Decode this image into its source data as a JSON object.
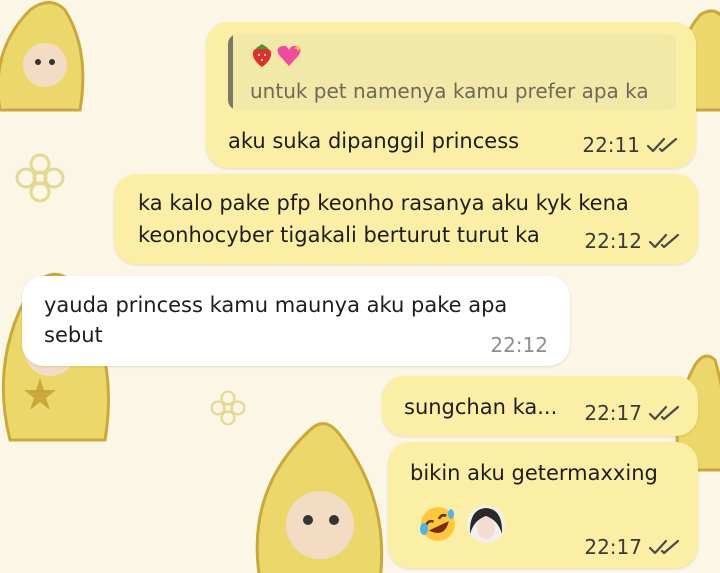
{
  "messages": [
    {
      "id": "m1",
      "direction": "outgoing",
      "reply_to": {
        "emojis": [
          "strawberry",
          "sparkling-heart"
        ],
        "text": "untuk pet namenya kamu prefer apa ka"
      },
      "lines": [
        "aku suka dipanggil princess"
      ],
      "time": "22:11",
      "status": "read"
    },
    {
      "id": "m2",
      "direction": "outgoing",
      "lines": [
        "ka kalo pake pfp keonho rasanya aku kyk kena",
        "keonhocyber tigakali berturut turut ka"
      ],
      "time": "22:12",
      "status": "read"
    },
    {
      "id": "m3",
      "direction": "incoming",
      "lines": [
        "yauda princess kamu maunya aku pake apa",
        "sebut"
      ],
      "time": "22:12"
    },
    {
      "id": "m4",
      "direction": "outgoing",
      "lines": [
        "sungchan ka..."
      ],
      "time": "22:17",
      "status": "read"
    },
    {
      "id": "m5",
      "direction": "outgoing",
      "lines": [
        "bikin aku getermaxxing"
      ],
      "reactions": [
        "rolling-on-floor-laughing",
        "avatar-sticker"
      ],
      "time": "22:17",
      "status": "read"
    }
  ],
  "colors": {
    "outgoing_bubble": "#fbefa6",
    "incoming_bubble": "#ffffff",
    "wallpaper": "#fbf6e6",
    "ticks": "#4a4a4a"
  }
}
